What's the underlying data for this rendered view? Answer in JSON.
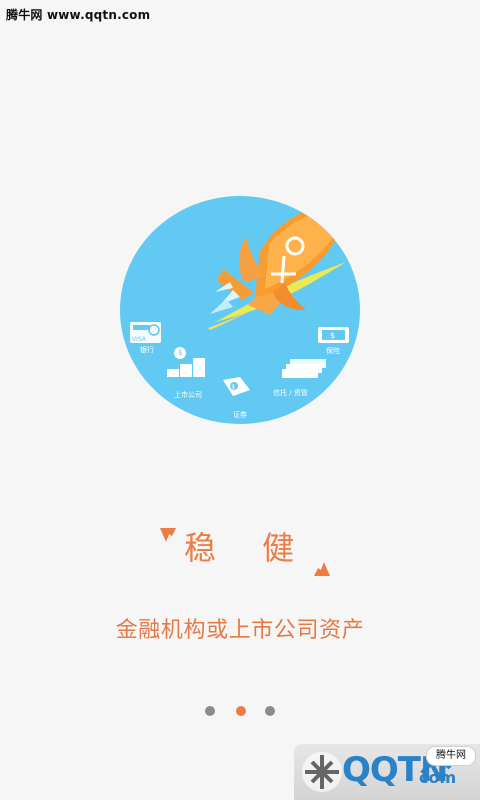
{
  "watermark": {
    "site_text": "腾牛网 www.qqtn.com"
  },
  "hero": {
    "labels": {
      "bank": "银行",
      "bank_card": "VISA",
      "listed": "上市公司",
      "securities": "证券",
      "trust": "信托 / 资管",
      "insurance": "保险"
    }
  },
  "headline": {
    "text": "稳 健"
  },
  "subtitle": {
    "text": "金融机构或上市公司资产"
  },
  "pager": {
    "active_index": 1
  },
  "brand_mark": {
    "text": "QQTN",
    "tail": "com",
    "badge": "腾牛网"
  },
  "colors": {
    "background": "#f6f6f6",
    "circle": "#62c9f2",
    "accent": "#ee7d45",
    "rocket": "#f59c34",
    "gray_dot": "#8b8b8b"
  }
}
